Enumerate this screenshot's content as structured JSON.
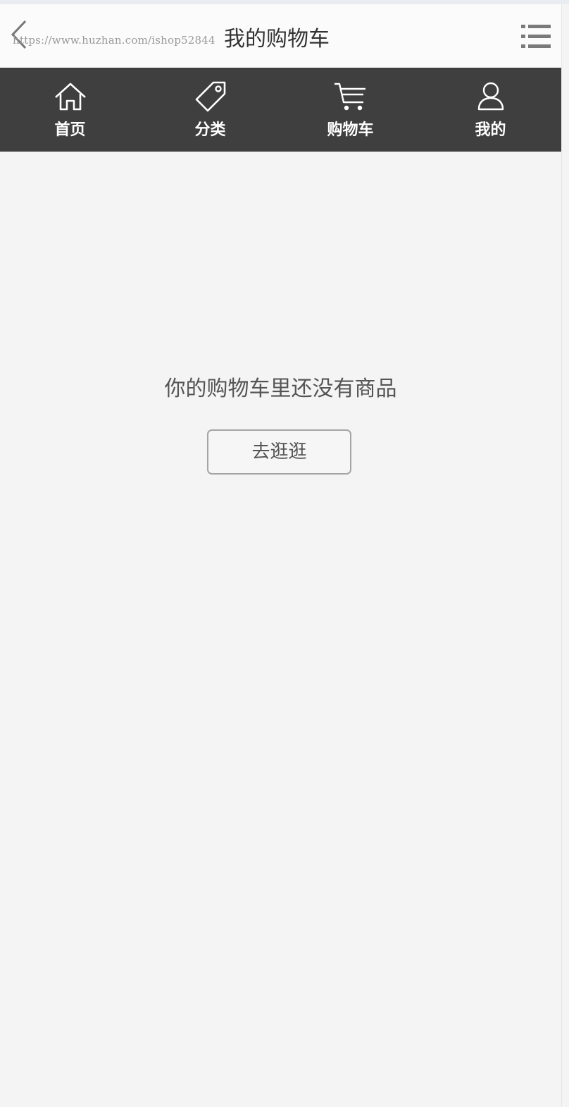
{
  "header": {
    "title": "我的购物车",
    "watermark": "https://www.huzhan.com/ishop52844"
  },
  "nav": {
    "items": [
      {
        "label": "首页",
        "icon": "home-icon"
      },
      {
        "label": "分类",
        "icon": "tag-icon"
      },
      {
        "label": "购物车",
        "icon": "cart-icon"
      },
      {
        "label": "我的",
        "icon": "user-icon"
      }
    ]
  },
  "cart": {
    "empty_message": "你的购物车里还没有商品",
    "go_shopping_label": "去逛逛"
  },
  "colors": {
    "nav_background": "#3f3f3f",
    "page_background": "#f4f4f4",
    "header_background": "#fbfbfb"
  }
}
